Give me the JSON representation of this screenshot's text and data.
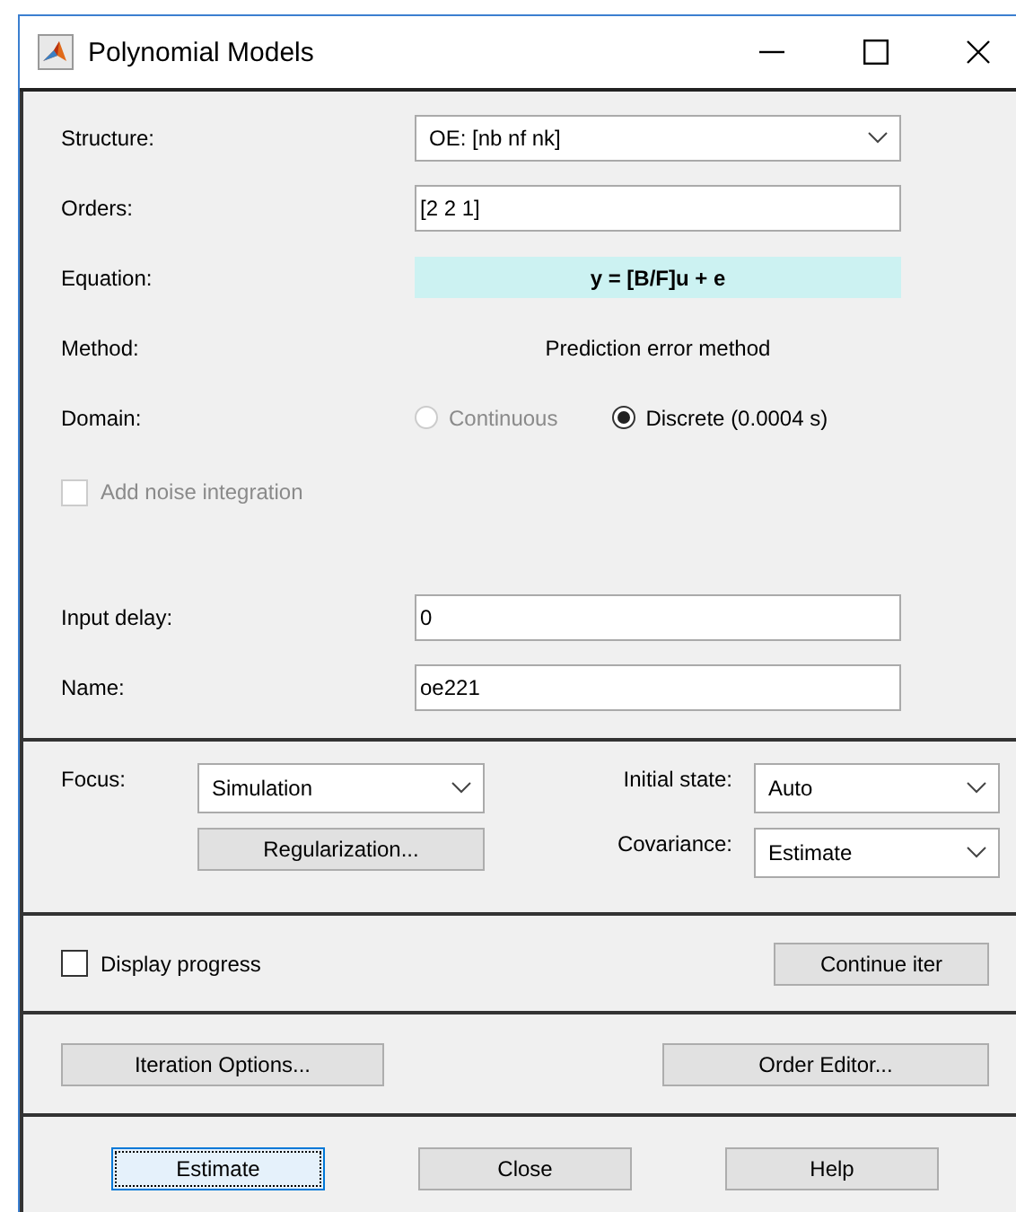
{
  "window": {
    "title": "Polynomial Models"
  },
  "model": {
    "structure": {
      "label": "Structure:",
      "value": "OE: [nb nf nk]"
    },
    "orders": {
      "label": "Orders:",
      "value": "[2 2 1]"
    },
    "equation": {
      "label": "Equation:",
      "value": "y = [B/F]u + e"
    },
    "method": {
      "label": "Method:",
      "value": "Prediction error method"
    },
    "domain": {
      "label": "Domain:",
      "options": [
        {
          "label": "Continuous",
          "selected": false,
          "disabled": true
        },
        {
          "label": "Discrete (0.0004 s)",
          "selected": true,
          "disabled": false
        }
      ]
    },
    "noise_integration": {
      "label": "Add noise integration",
      "checked": false,
      "disabled": true
    },
    "input_delay": {
      "label": "Input delay:",
      "value": "0"
    },
    "name": {
      "label": "Name:",
      "value": "oe221"
    }
  },
  "estimation": {
    "focus": {
      "label": "Focus:",
      "value": "Simulation"
    },
    "regularization_button": "Regularization...",
    "initial_state": {
      "label": "Initial state:",
      "value": "Auto"
    },
    "covariance": {
      "label": "Covariance:",
      "value": "Estimate"
    }
  },
  "progress": {
    "display_progress": {
      "label": "Display progress",
      "checked": false
    },
    "continue_button": "Continue iter"
  },
  "options": {
    "iteration_button": "Iteration Options...",
    "order_editor_button": "Order Editor..."
  },
  "buttons": [
    {
      "label": "Estimate",
      "focused": true
    },
    {
      "label": "Close",
      "focused": false
    },
    {
      "label": "Help",
      "focused": false
    }
  ]
}
